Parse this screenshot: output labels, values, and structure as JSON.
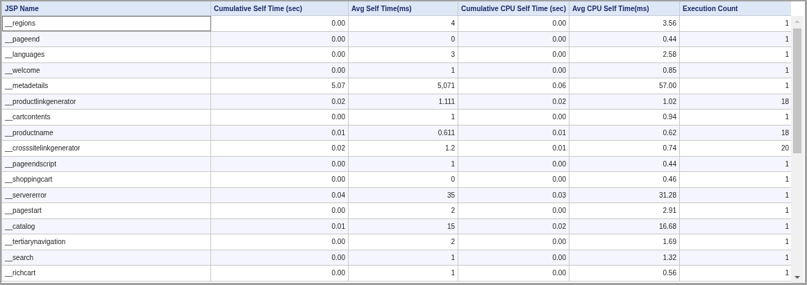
{
  "table": {
    "columns": [
      "JSP Name",
      "Cumulative Self Time (sec)",
      "Avg Self Time(ms)",
      "Cumulative CPU Self Time (sec)",
      "Avg CPU Self Time(ms)",
      "Execution Count"
    ],
    "rows": [
      {
        "cells": [
          "__regions",
          "0.00",
          "4",
          "0.00",
          "3.56",
          "1"
        ],
        "focused": true
      },
      {
        "cells": [
          "__pageend",
          "0.00",
          "0",
          "0.00",
          "0.44",
          "1"
        ],
        "focused": false
      },
      {
        "cells": [
          "__languages",
          "0.00",
          "3",
          "0.00",
          "2.58",
          "1"
        ],
        "focused": false
      },
      {
        "cells": [
          "__welcome",
          "0.00",
          "1",
          "0.00",
          "0.85",
          "1"
        ],
        "focused": false
      },
      {
        "cells": [
          "__metadetails",
          "5.07",
          "5,071",
          "0.06",
          "57.00",
          "1"
        ],
        "focused": false
      },
      {
        "cells": [
          "__productlinkgenerator",
          "0.02",
          "1.111",
          "0.02",
          "1.02",
          "18"
        ],
        "focused": false
      },
      {
        "cells": [
          "__cartcontents",
          "0.00",
          "1",
          "0.00",
          "0.94",
          "1"
        ],
        "focused": false
      },
      {
        "cells": [
          "__productname",
          "0.01",
          "0.611",
          "0.01",
          "0.62",
          "18"
        ],
        "focused": false
      },
      {
        "cells": [
          "__crosssitelinkgenerator",
          "0.02",
          "1.2",
          "0.01",
          "0.74",
          "20"
        ],
        "focused": false
      },
      {
        "cells": [
          "__pageendscript",
          "0.00",
          "1",
          "0.00",
          "0.44",
          "1"
        ],
        "focused": false
      },
      {
        "cells": [
          "__shoppingcart",
          "0.00",
          "0",
          "0.00",
          "0.46",
          "1"
        ],
        "focused": false
      },
      {
        "cells": [
          "__servererror",
          "0.04",
          "35",
          "0.03",
          "31.28",
          "1"
        ],
        "focused": false
      },
      {
        "cells": [
          "__pagestart",
          "0.00",
          "2",
          "0.00",
          "2.91",
          "1"
        ],
        "focused": false
      },
      {
        "cells": [
          "__catalog",
          "0.01",
          "15",
          "0.02",
          "16.68",
          "1"
        ],
        "focused": false
      },
      {
        "cells": [
          "__tertiarynavigation",
          "0.00",
          "2",
          "0.00",
          "1.69",
          "1"
        ],
        "focused": false
      },
      {
        "cells": [
          "__search",
          "0.00",
          "1",
          "0.00",
          "1.32",
          "1"
        ],
        "focused": false
      },
      {
        "cells": [
          "__richcart",
          "0.00",
          "1",
          "0.00",
          "0.56",
          "1"
        ],
        "focused": false
      }
    ]
  }
}
